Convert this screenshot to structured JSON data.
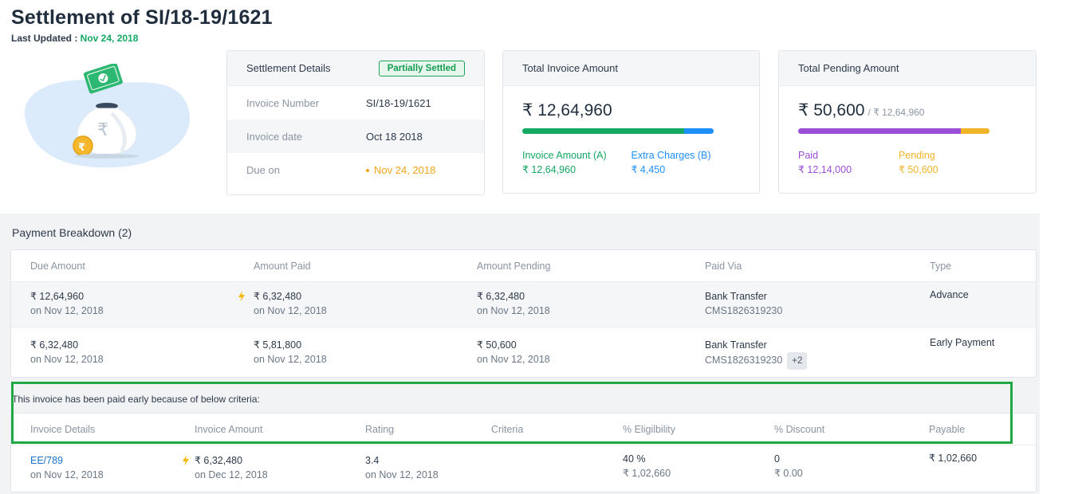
{
  "header": {
    "title": "Settlement of SI/18-19/1621",
    "last_updated_label": "Last Updated : ",
    "last_updated_value": "Nov 24, 2018"
  },
  "settlement_details": {
    "title": "Settlement Details",
    "status": "Partially Settled",
    "rows": [
      {
        "label": "Invoice Number",
        "value": "SI/18-19/1621"
      },
      {
        "label": "Invoice date",
        "value": "Oct 18 2018"
      },
      {
        "label": "Due on",
        "value": "Nov 24, 2018"
      }
    ]
  },
  "total_invoice": {
    "title": "Total Invoice Amount",
    "amount": "₹ 12,64,960",
    "bar_split": [
      0.845,
      0.155
    ],
    "colors": {
      "invoice": "#14a862",
      "extra": "#1e8fff"
    },
    "legend": [
      {
        "label": "Invoice Amount (A)",
        "value": "₹ 12,64,960"
      },
      {
        "label": "Extra Charges (B)",
        "value": "₹ 4,450"
      }
    ]
  },
  "total_pending": {
    "title": "Total Pending Amount",
    "amount": "₹ 50,600",
    "of_total": "/ ₹ 12,64,960",
    "bar_split": [
      0.85,
      0.15
    ],
    "colors": {
      "paid": "#9b4fd6",
      "pending": "#f0b429"
    },
    "legend": [
      {
        "label": "Paid",
        "value": "₹ 12,14,000"
      },
      {
        "label": "Pending",
        "value": "₹ 50,600"
      }
    ]
  },
  "payment_breakdown": {
    "title": "Payment Breakdown (2)",
    "headers": [
      "Due Amount",
      "Amount Paid",
      "Amount Pending",
      "Paid Via",
      "Type"
    ],
    "rows": [
      {
        "due": "₹ 12,64,960",
        "due_on": "on Nov 12, 2018",
        "paid": "₹ 6,32,480",
        "paid_on": "on Nov 12, 2018",
        "pending": "₹ 6,32,480",
        "pending_on": "on Nov 12, 2018",
        "via": "Bank Transfer",
        "ref": "CMS1826319230",
        "extra": "",
        "type": "Advance"
      },
      {
        "due": "₹ 6,32,480",
        "due_on": "on Nov 12, 2018",
        "paid": "₹ 5,81,800",
        "paid_on": "on Nov 12, 2018",
        "pending": "₹ 50,600",
        "pending_on": "on Nov 12, 2018",
        "via": "Bank Transfer",
        "ref": "CMS1826319230",
        "extra": "+2",
        "type": "Early Payment"
      }
    ]
  },
  "criteria": {
    "note": "This invoice has been paid early because of below criteria:",
    "headers": [
      "Invoice Details",
      "Invoice Amount",
      "Rating",
      "Criteria",
      "% Eligilbility",
      "% Discount",
      "Payable"
    ],
    "row": {
      "invoice": "EE/789",
      "invoice_on": "on Nov 12, 2018",
      "amount": "₹ 6,32,480",
      "amount_on": "on Dec 12, 2018",
      "rating": "3.4",
      "rating_on": "on Nov 12, 2018",
      "criteria": "",
      "eligibility": "40 %",
      "eligibility_amt": "₹ 1,02,660",
      "discount": "0",
      "discount_amt": "₹ 0.00",
      "payable": "₹ 1,02,660"
    }
  }
}
